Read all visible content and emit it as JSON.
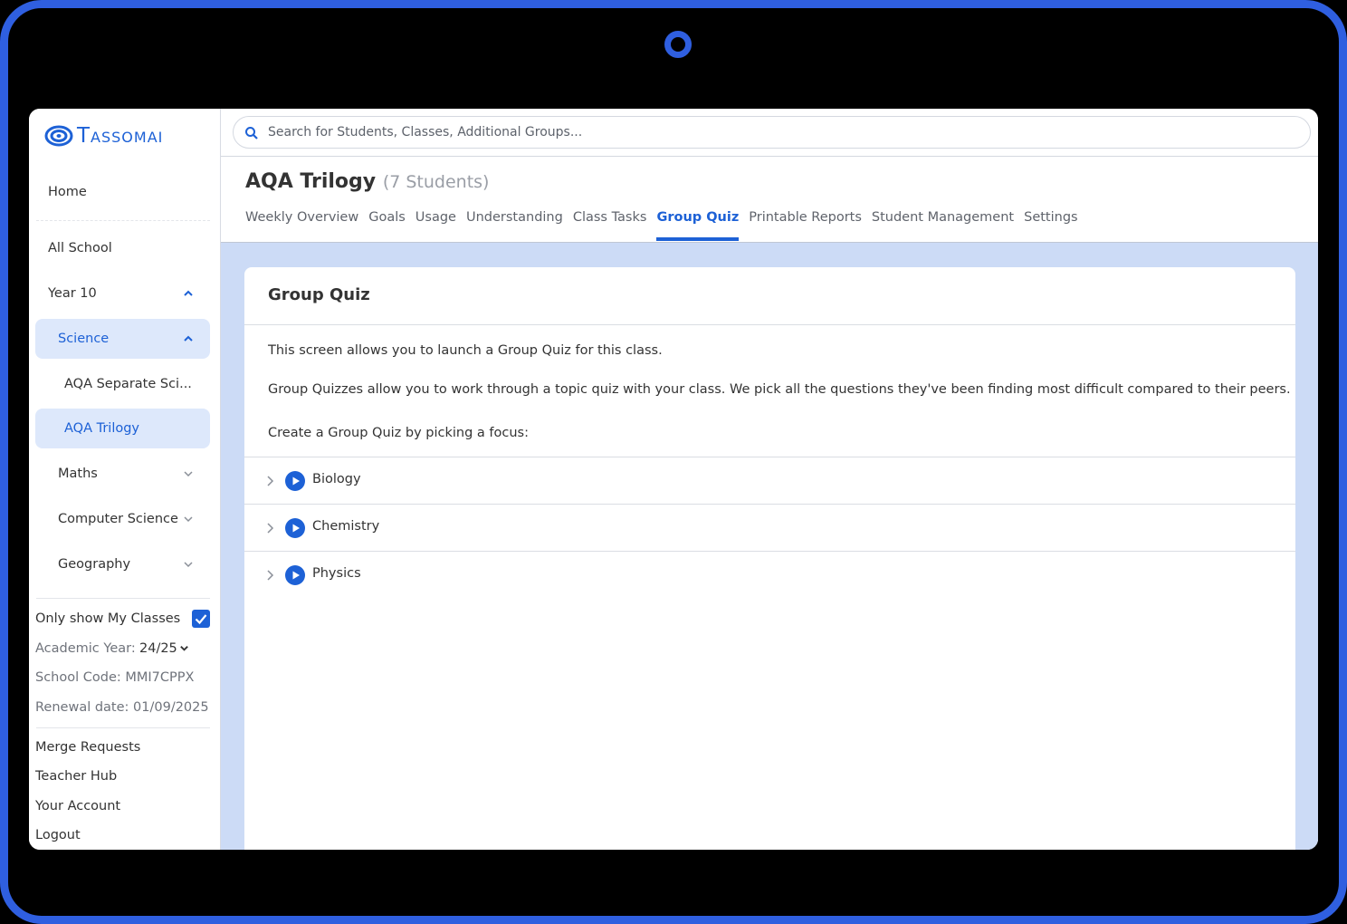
{
  "app": {
    "logo_text": "Tassomai",
    "brand_color": "#1d61d6",
    "frame_color": "#2f5fe0"
  },
  "sidebar": {
    "home": "Home",
    "all_school": "All School",
    "year": "Year 10",
    "science": "Science",
    "science_items": [
      "AQA Separate Sci...",
      "AQA Trilogy"
    ],
    "maths": "Maths",
    "computer_science": "Computer Science",
    "geography": "Geography",
    "only_show_my_classes": "Only show My Classes",
    "only_show_my_classes_checked": true,
    "academic_year_label": "Academic Year:",
    "academic_year_value": "24/25",
    "school_code": "School Code: MMI7CPPX",
    "renewal_date": "Renewal date: 01/09/2025",
    "links": [
      "Merge Requests",
      "Teacher Hub",
      "Your Account",
      "Logout"
    ]
  },
  "search": {
    "placeholder": "Search for Students, Classes, Additional Groups..."
  },
  "header": {
    "class_name": "AQA Trilogy",
    "student_count": "(7 Students)"
  },
  "tabs": [
    {
      "label": "Weekly Overview",
      "active": false
    },
    {
      "label": "Goals",
      "active": false
    },
    {
      "label": "Usage",
      "active": false
    },
    {
      "label": "Understanding",
      "active": false
    },
    {
      "label": "Class Tasks",
      "active": false
    },
    {
      "label": "Group Quiz",
      "active": true
    },
    {
      "label": "Printable Reports",
      "active": false
    },
    {
      "label": "Student Management",
      "active": false
    },
    {
      "label": "Settings",
      "active": false
    }
  ],
  "group_quiz": {
    "title": "Group Quiz",
    "intro": "This screen allows you to launch a Group Quiz for this class.",
    "description": "Group Quizzes allow you to work through a topic quiz with your class. We pick all the questions they've been finding most difficult compared to their peers.",
    "prompt": "Create a Group Quiz by picking a focus:",
    "subjects": [
      "Biology",
      "Chemistry",
      "Physics"
    ]
  }
}
